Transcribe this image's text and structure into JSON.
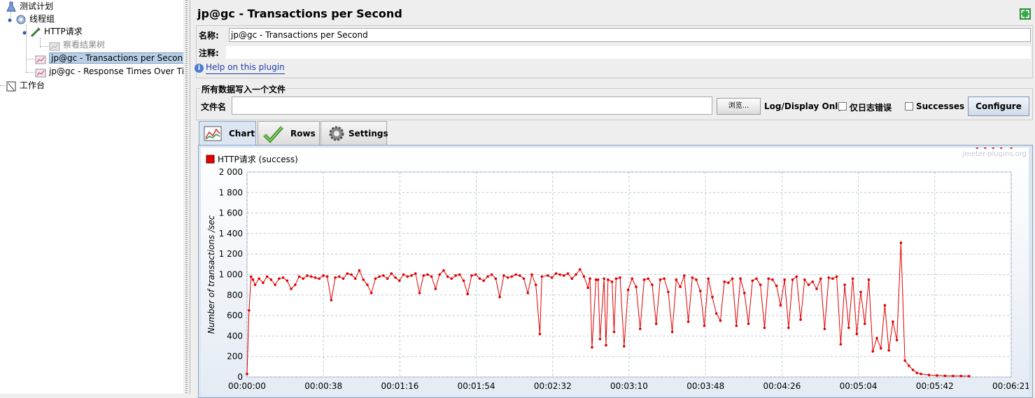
{
  "tree": {
    "items": [
      {
        "label": "测试计划"
      },
      {
        "label": "线程组"
      },
      {
        "label": "HTTP请求"
      },
      {
        "label": "察看结果树"
      },
      {
        "label": "jp@gc - Transactions per Second"
      },
      {
        "label": "jp@gc - Response Times Over Tim"
      },
      {
        "label": "工作台"
      }
    ]
  },
  "panel": {
    "title": "jp@gc - Transactions per Second",
    "name_label": "名称:",
    "name_value": "jp@gc - Transactions per Second",
    "comment_label": "注释:",
    "help_link": "Help on this plugin"
  },
  "file_section": {
    "title": "所有数据写入一个文件",
    "filename_label": "文件名",
    "filename_value": "",
    "browse_button": "浏览...",
    "log_display_label": "Log/Display Only:",
    "errors_checkbox": "仅日志错误",
    "successes_checkbox": "Successes",
    "configure_button": "Configure"
  },
  "tabs": [
    {
      "label": "Chart",
      "icon": "chart-icon"
    },
    {
      "label": "Rows",
      "icon": "checkmark-icon"
    },
    {
      "label": "Settings",
      "icon": "gear-icon"
    }
  ],
  "colors": {
    "series": "#e00000",
    "grid": "#b8c8d8",
    "accent_link": "#1a3ea8"
  },
  "chart_data": {
    "type": "line",
    "watermark": "jmeter-plugins.org",
    "ylabel": "Number of transactions /sec",
    "xlabel": "",
    "ylim": [
      0,
      2000
    ],
    "yticks": [
      "0",
      "200",
      "400",
      "600",
      "800",
      "1 000",
      "1 200",
      "1 400",
      "1 600",
      "1 800",
      "2 000"
    ],
    "xlim_seconds": [
      0,
      381
    ],
    "xticks": [
      "00:00:00",
      "00:00:38",
      "00:01:16",
      "00:01:54",
      "00:02:32",
      "00:03:10",
      "00:03:48",
      "00:04:26",
      "00:05:04",
      "00:05:42",
      "00:06:21"
    ],
    "grid": true,
    "legend_position": "top-left",
    "series": [
      {
        "name": "HTTP请求 (success)",
        "points_time_s": [
          0,
          1,
          2,
          3,
          4,
          6,
          8,
          10,
          12,
          14,
          16,
          18,
          20,
          22,
          24,
          26,
          28,
          30,
          32,
          34,
          36,
          38,
          40,
          42,
          44,
          46,
          48,
          50,
          52,
          54,
          56,
          58,
          60,
          62,
          64,
          66,
          68,
          70,
          72,
          74,
          76,
          78,
          80,
          82,
          84,
          86,
          88,
          90,
          92,
          94,
          96,
          98,
          100,
          102,
          104,
          106,
          108,
          110,
          112,
          114,
          116,
          118,
          120,
          122,
          124,
          126,
          128,
          130,
          132,
          134,
          136,
          138,
          140,
          142,
          144,
          146,
          147,
          150,
          152,
          154,
          156,
          158,
          160,
          162,
          164,
          166,
          168,
          170,
          171,
          172,
          174,
          175,
          176,
          178,
          179,
          180,
          182,
          183,
          184,
          186,
          188,
          190,
          192,
          194,
          196,
          198,
          200,
          202,
          204,
          206,
          208,
          210,
          212,
          214,
          216,
          218,
          220,
          222,
          224,
          226,
          228,
          230,
          232,
          234,
          236,
          238,
          240,
          242,
          244,
          246,
          248,
          250,
          252,
          254,
          256,
          258,
          260,
          262,
          264,
          266,
          268,
          270,
          272,
          274,
          276,
          278,
          280,
          282,
          284,
          286,
          288,
          290,
          292,
          294,
          296,
          298,
          300,
          302,
          304,
          306,
          308,
          310,
          312,
          314,
          316,
          318,
          320,
          322,
          324,
          326,
          328,
          330,
          332,
          334,
          336,
          340,
          344,
          348,
          352,
          356,
          360,
          364,
          368,
          372,
          376,
          381
        ],
        "values": [
          30,
          650,
          980,
          950,
          900,
          960,
          920,
          980,
          950,
          900,
          960,
          970,
          940,
          860,
          900,
          980,
          960,
          990,
          980,
          970,
          960,
          990,
          980,
          750,
          970,
          980,
          960,
          1010,
          1000,
          960,
          1040,
          950,
          900,
          820,
          960,
          980,
          990,
          960,
          1010,
          970,
          940,
          1000,
          980,
          990,
          1010,
          820,
          990,
          1000,
          980,
          860,
          1000,
          1040,
          980,
          960,
          990,
          1000,
          940,
          810,
          990,
          1000,
          960,
          940,
          980,
          1000,
          960,
          780,
          990,
          970,
          980,
          1000,
          990,
          960,
          820,
          1000,
          900,
          420,
          980,
          990,
          970,
          1010,
          1000,
          990,
          1010,
          960,
          1000,
          1050,
          980,
          870,
          960,
          290,
          950,
          950,
          370,
          960,
          310,
          950,
          930,
          440,
          960,
          970,
          300,
          850,
          960,
          880,
          470,
          950,
          960,
          900,
          520,
          950,
          960,
          830,
          440,
          950,
          880,
          990,
          540,
          970,
          950,
          840,
          500,
          960,
          780,
          620,
          550,
          930,
          920,
          960,
          500,
          960,
          820,
          520,
          940,
          960,
          900,
          480,
          960,
          950,
          890,
          700,
          950,
          480,
          950,
          980,
          560,
          950,
          900,
          930,
          860,
          960,
          470,
          970,
          960,
          980,
          320,
          900,
          480,
          960,
          420,
          830,
          520,
          950,
          250,
          380,
          280,
          700,
          260,
          540,
          360,
          1310,
          160,
          110,
          70,
          40,
          30,
          20,
          15,
          12,
          10,
          10,
          8
        ]
      }
    ]
  }
}
